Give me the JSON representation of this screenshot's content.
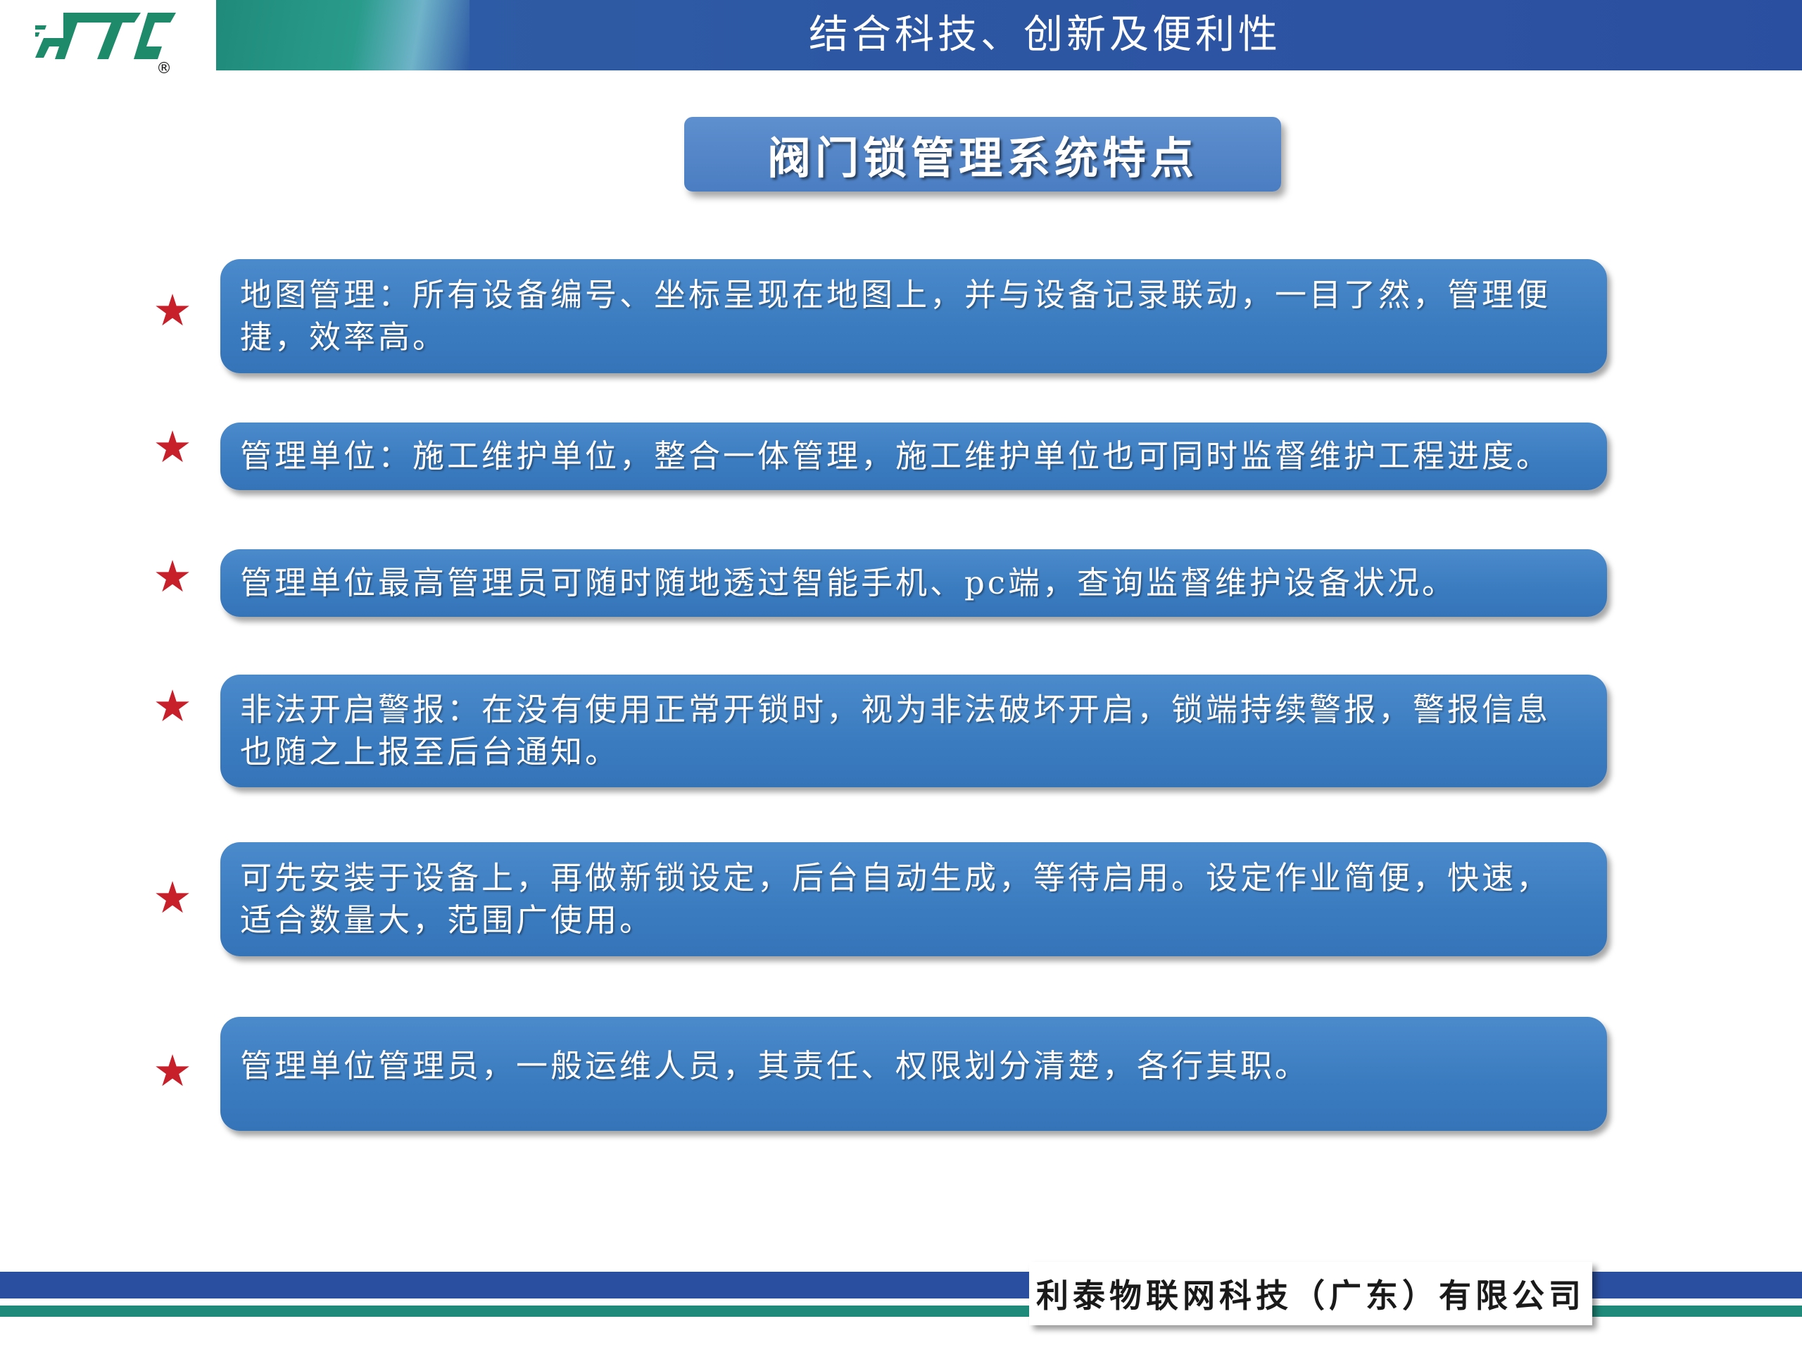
{
  "header": {
    "title": "结合科技、创新及便利性"
  },
  "logo": {
    "text": "JTC",
    "mark": "®",
    "color": "#1f8a6a"
  },
  "section_heading": "阀门锁管理系统特点",
  "features": [
    {
      "text": "地图管理：所有设备编号、坐标呈现在地图上，并与设备记录联动，一目了然，管理便捷，效率高。"
    },
    {
      "text": "管理单位：施工维护单位，整合一体管理，施工维护单位也可同时监督维护工程进度。"
    },
    {
      "text": "管理单位最高管理员可随时随地透过智能手机、pc端，查询监督维护设备状况。"
    },
    {
      "text": "非法开启警报：在没有使用正常开锁时，视为非法破坏开启，锁端持续警报，警报信息也随之上报至后台通知。"
    },
    {
      "text": "可先安装于设备上，再做新锁设定，后台自动生成，等待启用。设定作业简便，快速，适合数量大，范围广使用。"
    },
    {
      "text": "管理单位管理员，一般运维人员，其责任、权限划分清楚，各行其职。"
    }
  ],
  "star_glyph": "★",
  "footer": {
    "company": "利泰物联网科技（广东）有限公司"
  },
  "colors": {
    "header_blue": "#2d57a3",
    "teal": "#1f8a7a",
    "box_blue": "#3a7bbf",
    "star_red": "#c8202a"
  }
}
